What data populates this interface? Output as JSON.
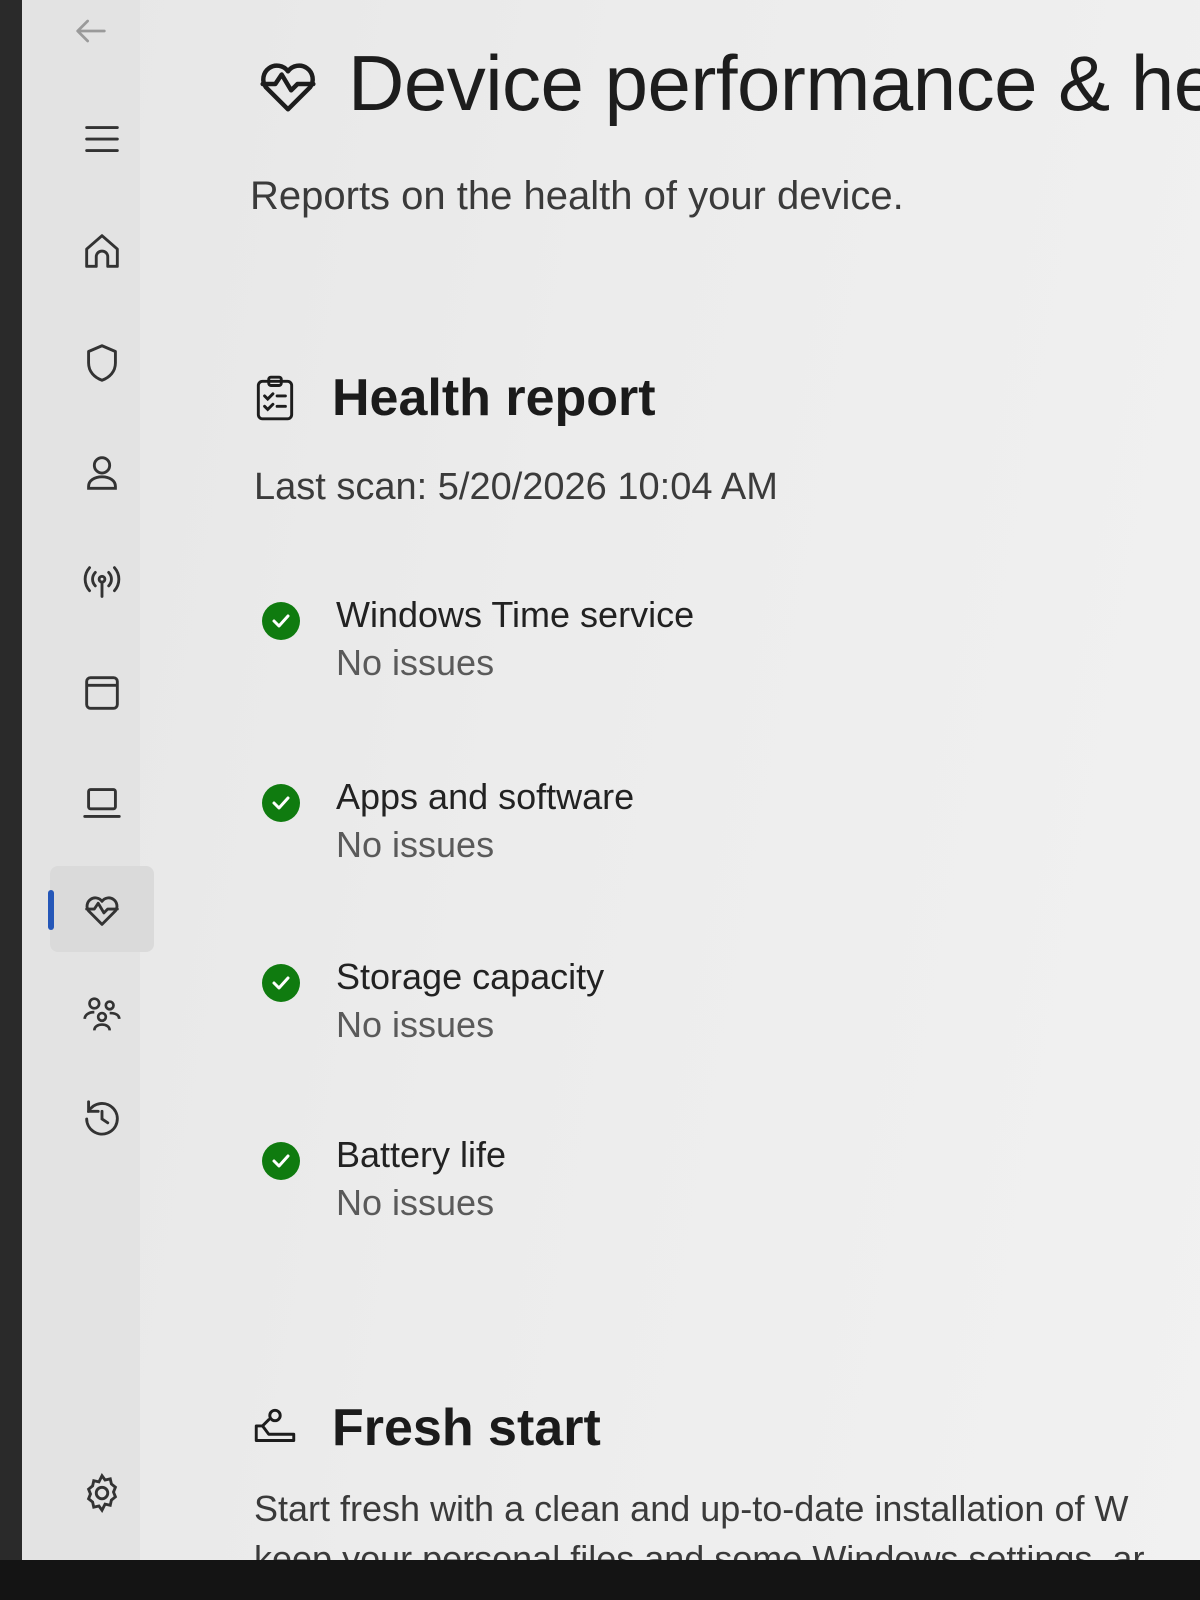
{
  "nav": {
    "items": [
      {
        "icon": "hamburger-menu-icon"
      },
      {
        "icon": "home-icon"
      },
      {
        "icon": "shield-icon"
      },
      {
        "icon": "person-icon"
      },
      {
        "icon": "wireless-antenna-icon"
      },
      {
        "icon": "app-window-icon"
      },
      {
        "icon": "laptop-icon"
      },
      {
        "icon": "heart-pulse-icon",
        "active": true
      },
      {
        "icon": "family-icon"
      },
      {
        "icon": "history-icon"
      },
      {
        "icon": "settings-gear-icon"
      }
    ],
    "accent_color": "#2557b8"
  },
  "page": {
    "title": "Device performance & he",
    "subtitle": "Reports on the health of your device."
  },
  "health_report": {
    "title": "Health report",
    "last_scan": "Last scan: 5/20/2026 10:04 AM",
    "items": [
      {
        "title": "Windows Time service",
        "status": "No issues"
      },
      {
        "title": "Apps and software",
        "status": "No issues"
      },
      {
        "title": "Storage capacity",
        "status": "No issues"
      },
      {
        "title": "Battery life",
        "status": "No issues"
      }
    ],
    "ok_color": "#0f7b0f"
  },
  "fresh_start": {
    "title": "Fresh start",
    "desc_line1": "Start fresh with a clean and up-to-date installation of W",
    "desc_line2": "keep your personal files and some Windows settings, ar"
  }
}
